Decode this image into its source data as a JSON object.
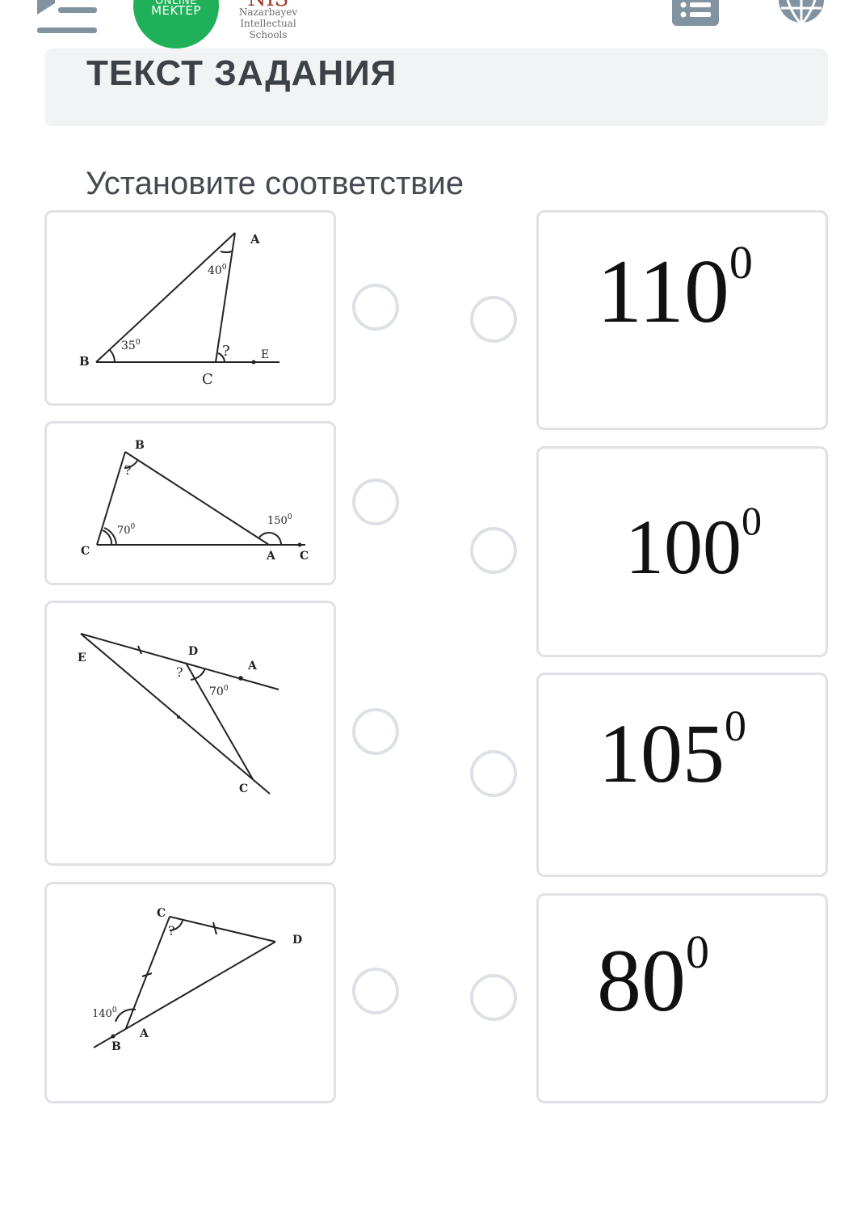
{
  "header": {
    "menu_icon": "menu-collapse-icon",
    "logo_online_mektep": {
      "line1": "ONLINE",
      "line2": "MEKTEP"
    },
    "logo_nis": {
      "mark": "NIS",
      "line1": "Nazarbayev",
      "line2": "Intellectual",
      "line3": "Schools"
    },
    "list_icon": "list-icon",
    "globe_icon": "globe-icon"
  },
  "task": {
    "section_title": "ТЕКСТ ЗАДАНИЯ",
    "instruction": "Установите соответствие"
  },
  "left_items": [
    {
      "labels": {
        "a": "A",
        "b": "B",
        "c": "C",
        "e": "E",
        "angle_a": "40",
        "angle_b": "35",
        "unknown": "?"
      }
    },
    {
      "labels": {
        "b": "B",
        "c": "C",
        "a": "A",
        "c2": "C",
        "angle_c": "70",
        "angle_ext": "150",
        "unknown": "?"
      }
    },
    {
      "labels": {
        "e": "E",
        "d": "D",
        "a": "A",
        "c": "C",
        "angle": "70",
        "unknown": "?"
      }
    },
    {
      "labels": {
        "c": "C",
        "d": "D",
        "a": "A",
        "b": "B",
        "angle_ext": "140",
        "unknown": "?"
      }
    }
  ],
  "right_items": [
    {
      "value": "110",
      "degree": "0"
    },
    {
      "value": "100",
      "degree": "0"
    },
    {
      "value": "105",
      "degree": "0"
    },
    {
      "value": "80",
      "degree": "0"
    }
  ],
  "colors": {
    "accent_green": "#21b05a",
    "header_bg": "#f2f3f5",
    "card_border": "#dfe1e4",
    "radio_border": "#dde0e4",
    "icon_gray": "#8193a1"
  }
}
